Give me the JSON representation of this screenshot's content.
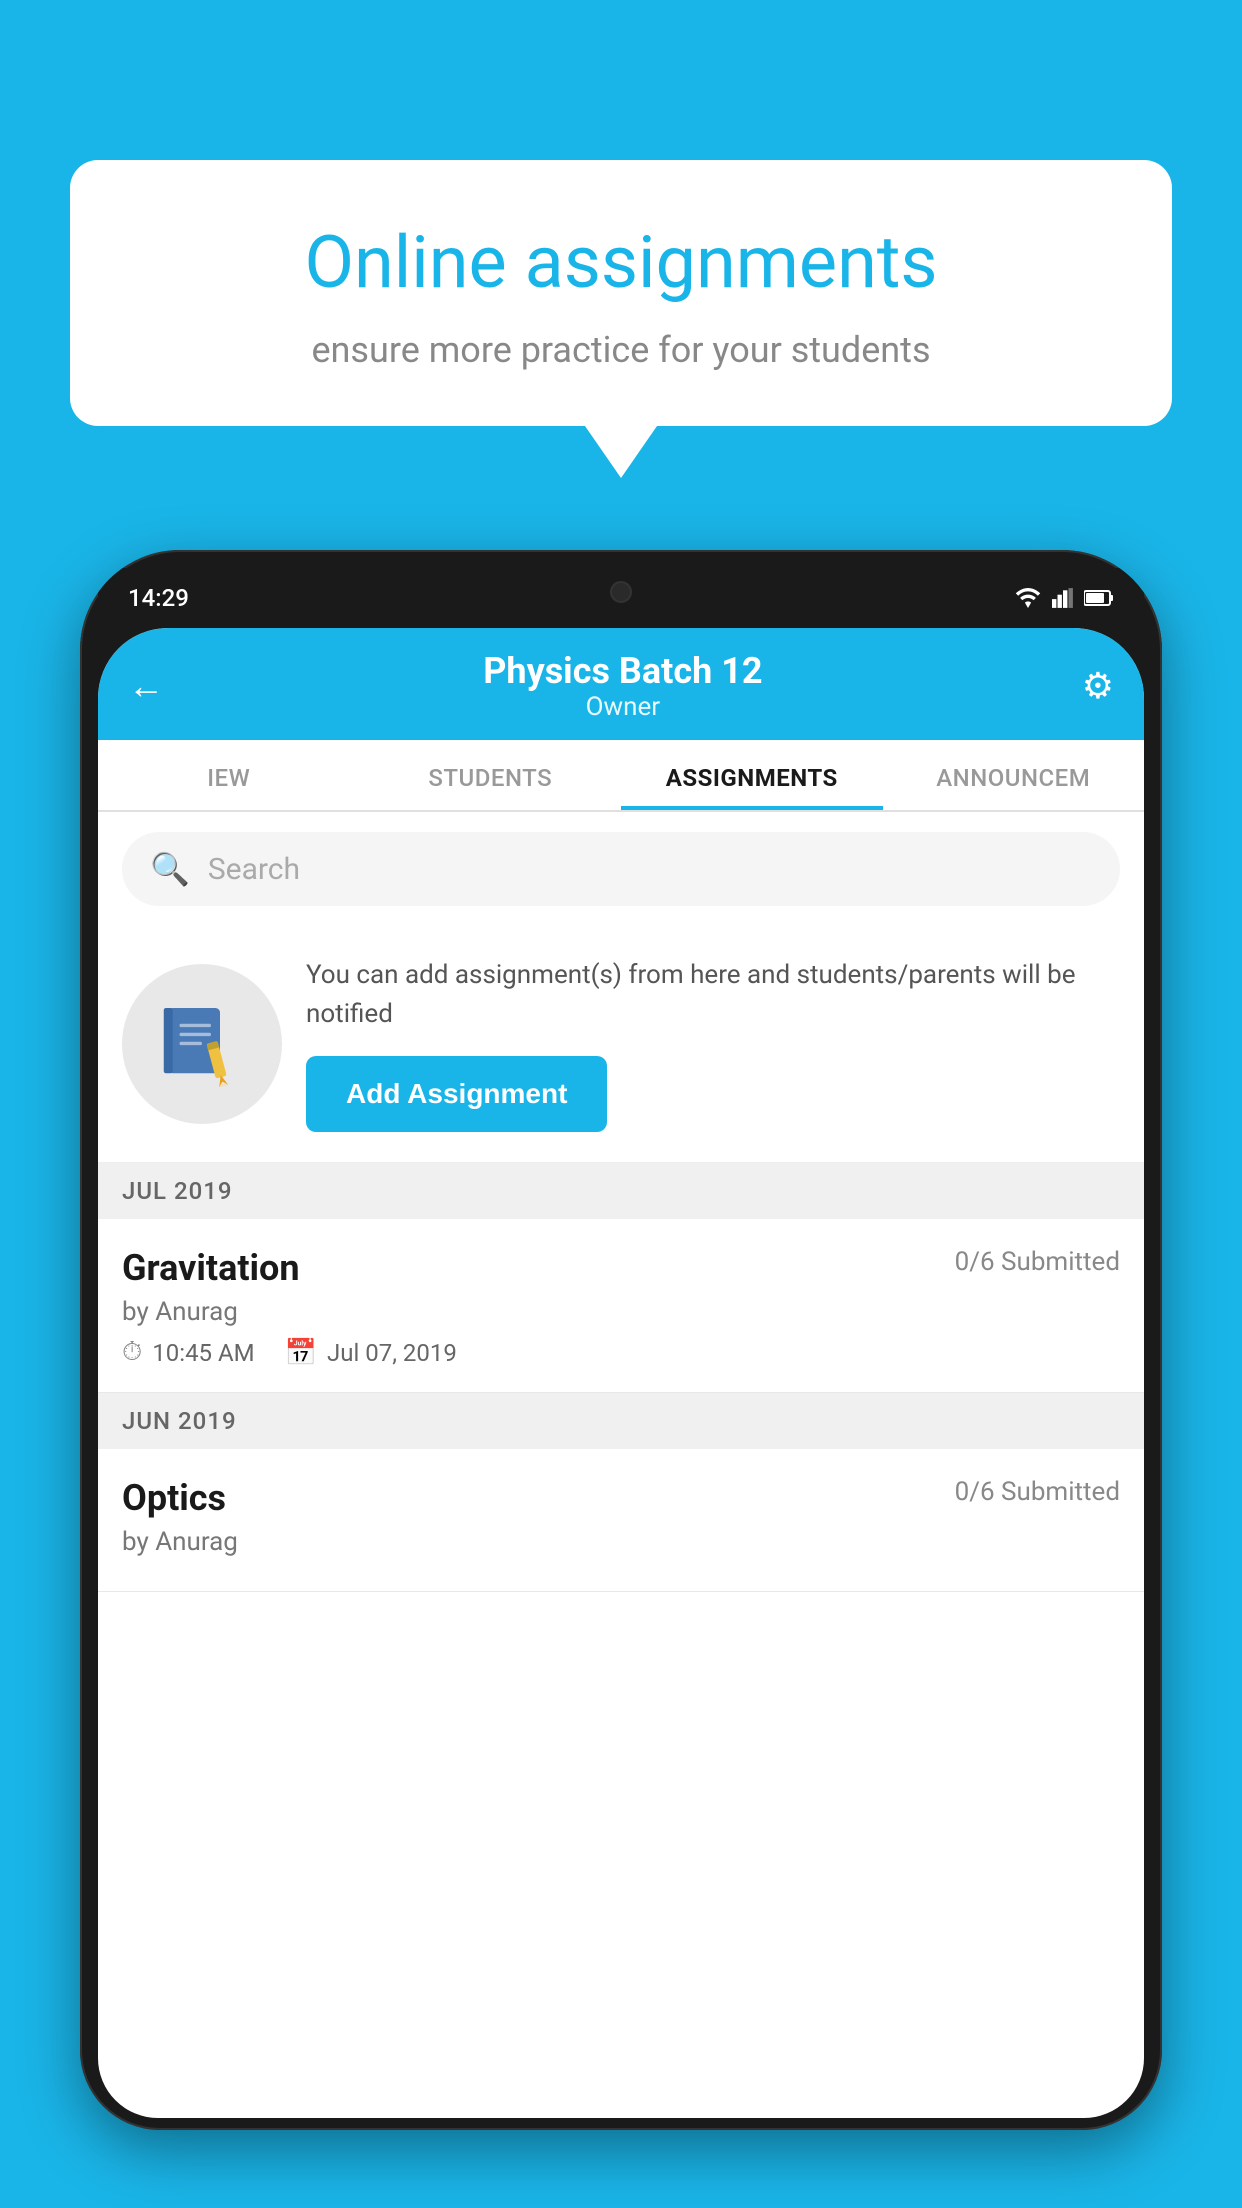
{
  "background_color": "#1ab5e8",
  "speech_bubble": {
    "title": "Online assignments",
    "subtitle": "ensure more practice for your students"
  },
  "phone": {
    "status_bar": {
      "time": "14:29",
      "icons": [
        "wifi",
        "signal",
        "battery"
      ]
    },
    "header": {
      "title": "Physics Batch 12",
      "subtitle": "Owner",
      "back_label": "←",
      "gear_label": "⚙"
    },
    "tabs": [
      {
        "label": "IEW",
        "active": false
      },
      {
        "label": "STUDENTS",
        "active": false
      },
      {
        "label": "ASSIGNMENTS",
        "active": true
      },
      {
        "label": "ANNOUNCEM",
        "active": false
      }
    ],
    "search": {
      "placeholder": "Search"
    },
    "add_assignment_section": {
      "description": "You can add assignment(s) from here and students/parents will be notified",
      "button_label": "Add Assignment"
    },
    "month_sections": [
      {
        "month_label": "JUL 2019",
        "assignments": [
          {
            "title": "Gravitation",
            "submitted": "0/6 Submitted",
            "author": "by Anurag",
            "time": "10:45 AM",
            "date": "Jul 07, 2019"
          }
        ]
      },
      {
        "month_label": "JUN 2019",
        "assignments": [
          {
            "title": "Optics",
            "submitted": "0/6 Submitted",
            "author": "by Anurag",
            "time": "",
            "date": ""
          }
        ]
      }
    ]
  }
}
